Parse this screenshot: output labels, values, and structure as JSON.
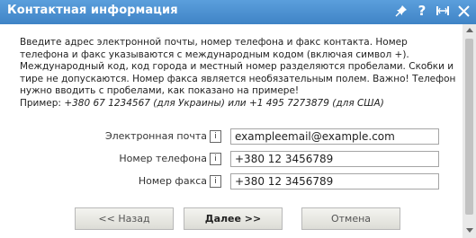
{
  "dialog": {
    "title": "Контактная информация"
  },
  "titlebar_icons": [
    "pin-icon",
    "help-icon",
    "fit-width-icon",
    "close-icon"
  ],
  "description": {
    "text": "Введите адрес электронной почты, номер телефона и факс контакта. Номер телефона и факс указываются с международным кодом (включая символ +). Международный код, код города и местный номер разделяются пробелами. Скобки и тире не допускаются. Номер факса является необязательным полем. Важно! Телефон нужно вводить с пробелами, как показано на примере!",
    "example_label": "Пример:",
    "example_text": "+380 67 1234567 (для Украины) или +1 495 7273879 (для США)"
  },
  "form": {
    "email": {
      "label": "Электронная почта",
      "value": "exampleemail@example.com"
    },
    "phone": {
      "label": "Номер телефона",
      "value": "+380 12 3456789"
    },
    "fax": {
      "label": "Номер факса",
      "value": "+380 12 3456789"
    },
    "info_glyph": "i"
  },
  "buttons": {
    "back": "<< Назад",
    "next": "Далее >>",
    "cancel": "Отмена"
  }
}
